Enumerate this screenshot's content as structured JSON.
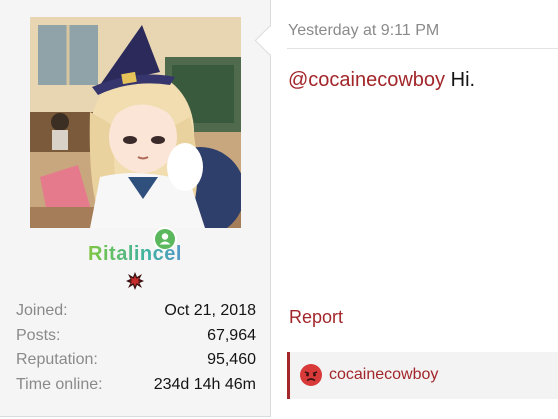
{
  "user": {
    "username": "Ritalincel",
    "avatar_icon": "anime-girl-avatar-image",
    "online_icon": "user-online-icon",
    "badge_icon": "angry-burst-icon",
    "stats": [
      {
        "label": "Joined:",
        "value": "Oct 21, 2018"
      },
      {
        "label": "Posts:",
        "value": "67,964"
      },
      {
        "label": "Reputation:",
        "value": "95,460"
      },
      {
        "label": "Time online:",
        "value": "234d 14h 46m"
      }
    ]
  },
  "post": {
    "date": "Yesterday at 9:11 PM",
    "mention": "@cocainecowboy",
    "text": " Hi.",
    "report_label": "Report",
    "reactions": {
      "icon": "angry-face-icon",
      "user": "cocainecowboy"
    }
  },
  "colors": {
    "accent": "#a2262a",
    "online": "#5cb85c",
    "sidebar_bg": "#f5f5f5"
  }
}
